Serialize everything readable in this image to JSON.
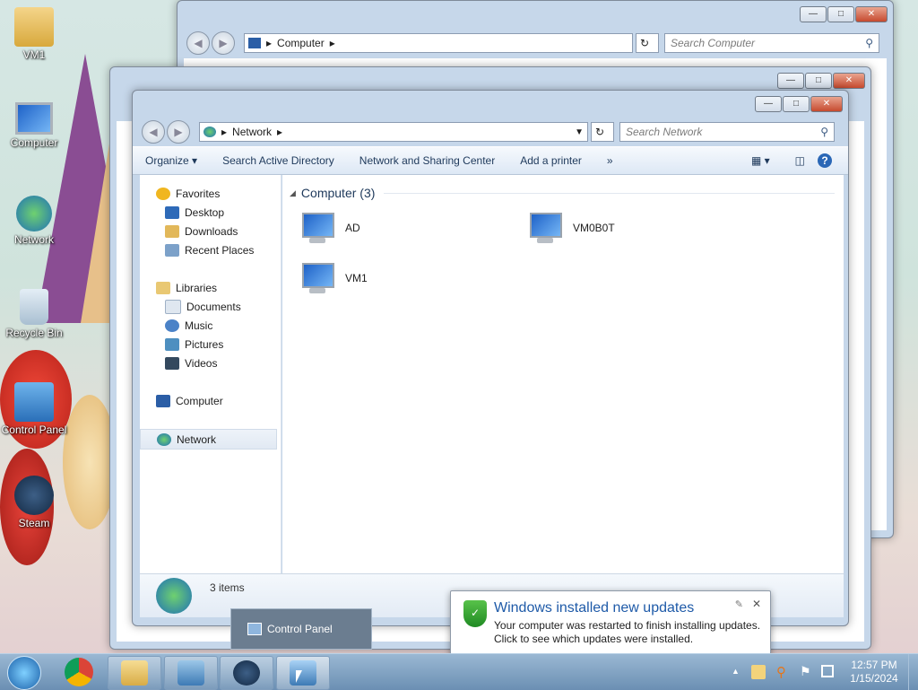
{
  "desktop": {
    "icons": [
      {
        "label": "VM1",
        "icon": "user-folder-icon"
      },
      {
        "label": "Computer",
        "icon": "computer-icon"
      },
      {
        "label": "Network",
        "icon": "network-icon"
      },
      {
        "label": "Recycle Bin",
        "icon": "recycle-bin-icon"
      },
      {
        "label": "Control Panel",
        "icon": "control-panel-icon"
      },
      {
        "label": "Steam",
        "icon": "steam-icon"
      }
    ]
  },
  "back_window": {
    "address": "Computer",
    "search_placeholder": "Search Computer"
  },
  "window": {
    "address": "Network",
    "search_placeholder": "Search Network",
    "toolbar": {
      "organize": "Organize",
      "search_ad": "Search Active Directory",
      "network_sharing": "Network and Sharing Center",
      "add_printer": "Add a printer",
      "more": "»"
    },
    "nav": {
      "favorites": "Favorites",
      "desktop": "Desktop",
      "downloads": "Downloads",
      "recent": "Recent Places",
      "libraries": "Libraries",
      "documents": "Documents",
      "music": "Music",
      "pictures": "Pictures",
      "videos": "Videos",
      "computer": "Computer",
      "network": "Network"
    },
    "group_header": "Computer (3)",
    "items": [
      "AD",
      "VM0B0T",
      "VM1"
    ],
    "status": "3 items"
  },
  "thumbnail": {
    "label": "Control Panel"
  },
  "notification": {
    "title": "Windows installed new updates",
    "line1": "Your computer was restarted to finish installing updates.",
    "line2": "Click to see which updates were installed."
  },
  "clock": {
    "time": "12:57 PM",
    "date": "1/15/2024"
  },
  "colors": {
    "accent": "#1e5aa8",
    "title_blue": "#1e395b"
  }
}
